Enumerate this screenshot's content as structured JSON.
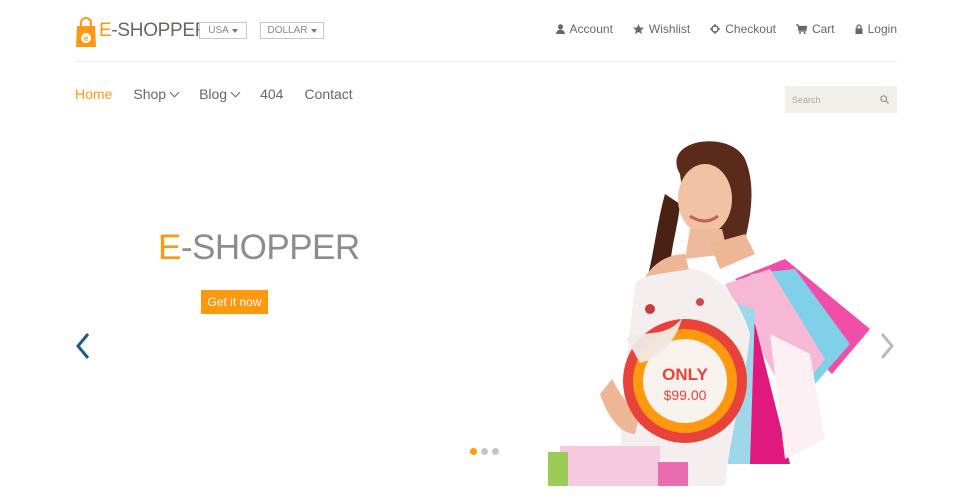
{
  "header": {
    "brand": {
      "prefix": "E",
      "rest": "-SHOPPER"
    },
    "country": {
      "label": "USA"
    },
    "currency": {
      "label": "DOLLAR"
    },
    "shop_menu": [
      {
        "label": "Account",
        "icon": "user-icon"
      },
      {
        "label": "Wishlist",
        "icon": "star-icon"
      },
      {
        "label": "Checkout",
        "icon": "crosshairs-icon"
      },
      {
        "label": "Cart",
        "icon": "shopping-cart-icon"
      },
      {
        "label": "Login",
        "icon": "lock-icon"
      }
    ]
  },
  "nav": {
    "items": [
      {
        "label": "Home",
        "active": true
      },
      {
        "label": "Shop",
        "dropdown": true
      },
      {
        "label": "Blog",
        "dropdown": true
      },
      {
        "label": "404"
      },
      {
        "label": "Contact"
      }
    ],
    "search": {
      "placeholder": "Search"
    }
  },
  "hero": {
    "title": {
      "prefix": "E",
      "rest": "-SHOPPER"
    },
    "button_label": "Get it now",
    "badge": {
      "line1": "ONLY",
      "line2": "$99.00"
    },
    "slide_count": 3,
    "active_slide": 0
  },
  "colors": {
    "accent": "#FE980F",
    "text": "#696763",
    "arrow_left": "#1F5A8C",
    "arrow_right": "#BBBBBB",
    "badge_red": "#E8433A"
  }
}
